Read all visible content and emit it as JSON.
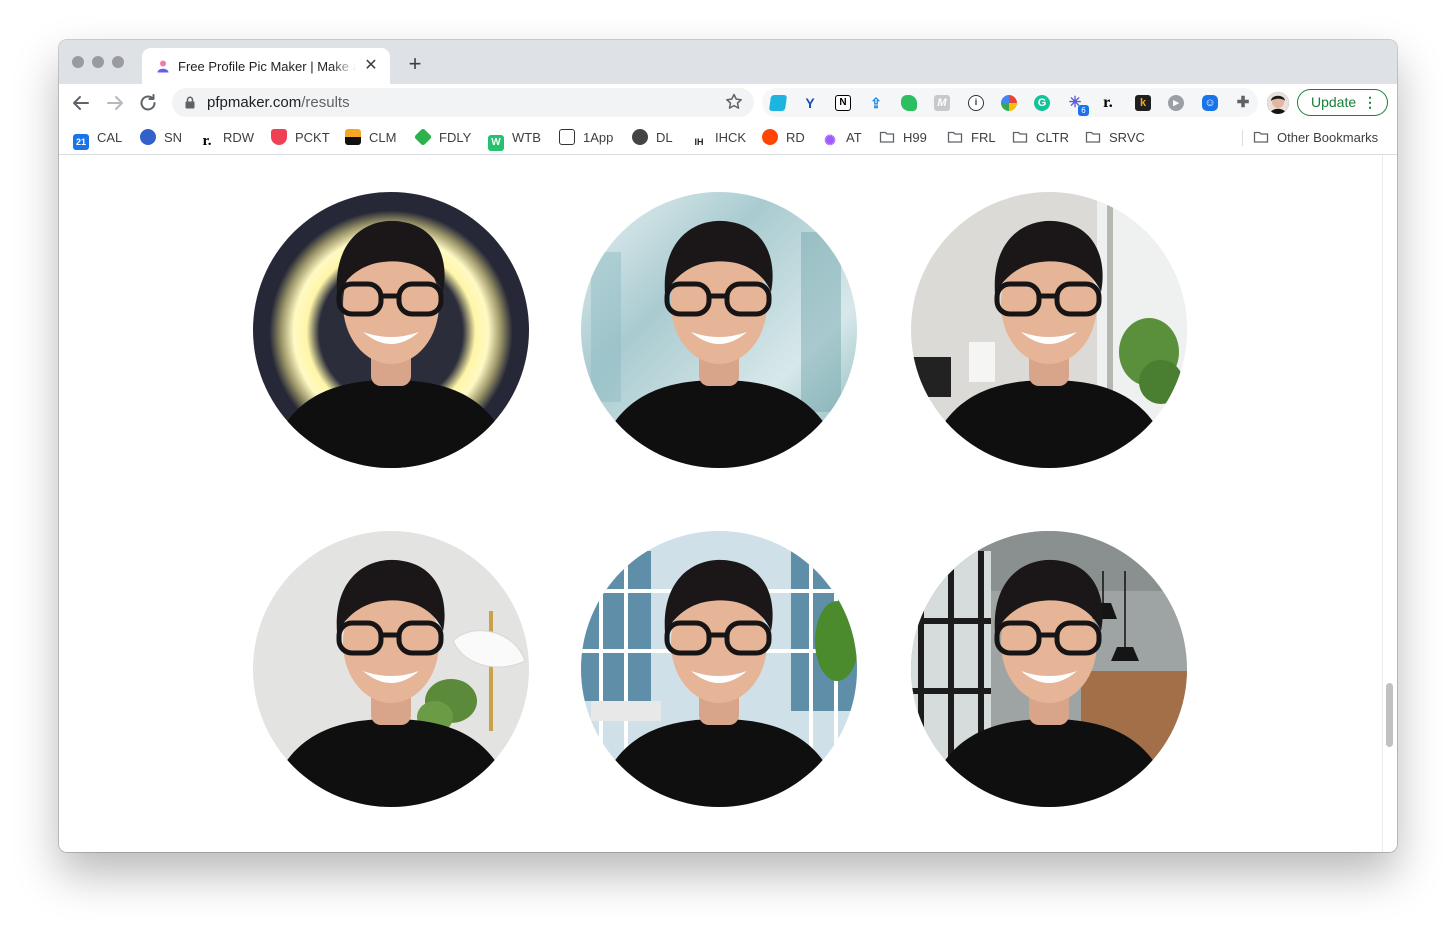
{
  "browser": {
    "tab": {
      "title": "Free Profile Pic Maker | Make a",
      "favicon": "person-favicon-icon"
    },
    "new_tab_label": "+",
    "address_bar": {
      "domain": "pfpmaker.com",
      "path": "/results"
    },
    "update_label": "Update",
    "menu_icon": "vertical-dots-icon",
    "extension_badge": "6"
  },
  "bookmarks": [
    {
      "label": "CAL",
      "icon": "calendar-icon",
      "icon_text": "21",
      "color": "#1a73e8"
    },
    {
      "label": "SN",
      "icon": "simplenote-icon",
      "icon_text": "",
      "color": "#3361cc"
    },
    {
      "label": "RDW",
      "icon": "readwise-icon",
      "icon_text": "r.",
      "color": "#000000"
    },
    {
      "label": "PCKT",
      "icon": "pocket-icon",
      "icon_text": "",
      "color": "#ef4056"
    },
    {
      "label": "CLM",
      "icon": "clm-icon",
      "icon_text": "",
      "color": "#111111"
    },
    {
      "label": "FDLY",
      "icon": "feedly-icon",
      "icon_text": "",
      "color": "#2bb24c"
    },
    {
      "label": "WTB",
      "icon": "wtb-icon",
      "icon_text": "W",
      "color": "#25c16f"
    },
    {
      "label": "1App",
      "icon": "news-icon",
      "icon_text": "",
      "color": "#333333"
    },
    {
      "label": "DL",
      "icon": "globe-icon",
      "icon_text": "",
      "color": "#444444"
    },
    {
      "label": "IHCK",
      "icon": "ihck-icon",
      "icon_text": "IH",
      "color": "#222222"
    },
    {
      "label": "RD",
      "icon": "reddit-icon",
      "icon_text": "",
      "color": "#ff4500"
    },
    {
      "label": "AT",
      "icon": "at-icon",
      "icon_text": "",
      "color": "#a259ff"
    },
    {
      "label": "H99",
      "icon": "folder-icon",
      "icon_text": "",
      "color": "#5f6368"
    },
    {
      "label": "FRL",
      "icon": "folder-icon",
      "icon_text": "",
      "color": "#5f6368"
    },
    {
      "label": "CLTR",
      "icon": "folder-icon",
      "icon_text": "",
      "color": "#5f6368"
    },
    {
      "label": "SRVC",
      "icon": "folder-icon",
      "icon_text": "",
      "color": "#5f6368"
    }
  ],
  "other_bookmarks_label": "Other Bookmarks",
  "results": [
    {
      "name": "pfp-result-glow-ring",
      "background": "dark navy with glowing yellow ring"
    },
    {
      "name": "pfp-result-blurred-office",
      "background": "blurred teal office"
    },
    {
      "name": "pfp-result-room-window",
      "background": "grey room with window and plant"
    },
    {
      "name": "pfp-result-white-lamp",
      "background": "white wall with lamp and plant"
    },
    {
      "name": "pfp-result-glass-office",
      "background": "glass office windows"
    },
    {
      "name": "pfp-result-loft",
      "background": "loft with pendant lamps"
    }
  ]
}
